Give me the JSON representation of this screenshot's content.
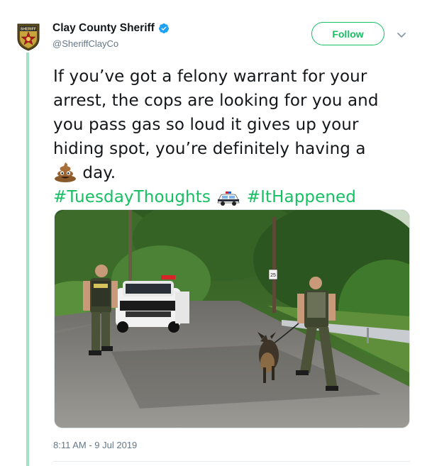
{
  "account": {
    "display_name": "Clay County Sheriff",
    "handle": "@SheriffClayCo",
    "verified": true,
    "avatar_icon": "sheriff-badge-icon",
    "avatar_text": "SHERIFF"
  },
  "actions": {
    "follow_label": "Follow",
    "menu_icon": "chevron-down-icon"
  },
  "tweet": {
    "lines": [
      "If you’ve got a felony warrant for your",
      "arrest, the cops are looking for you and",
      "you pass gas so loud it gives up your",
      "hiding spot, you’re definitely having a"
    ],
    "last_line_emoji": "pile-of-poo-emoji",
    "last_line_text": " day.",
    "hashtag_1": "#TuesdayThoughts",
    "hashtag_emoji": "police-car-emoji",
    "hashtag_2": "#ItHappened",
    "photo_description_icon": "photo-icon",
    "sign_text": "25"
  },
  "timestamp": "8:11 AM - 9 Jul 2019",
  "colors": {
    "accent": "#17bf63",
    "thread_line": "#a3e2c4",
    "text": "#14171a",
    "secondary": "#657786"
  }
}
